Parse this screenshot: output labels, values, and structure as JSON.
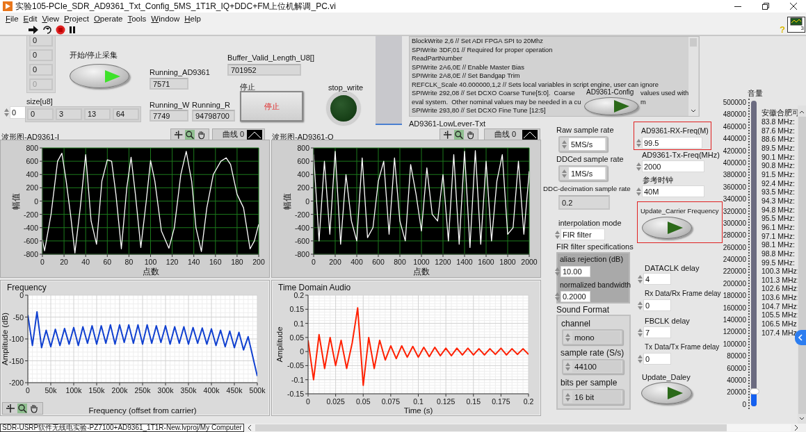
{
  "window": {
    "title": "实验105-PCIe_SDR_AD9361_Txt_Config_5MS_1T1R_IQ+DDC+FM上位机解调_PC.vi"
  },
  "menu": [
    "File",
    "Edit",
    "View",
    "Project",
    "Operate",
    "Tools",
    "Window",
    "Help"
  ],
  "help": "?",
  "vi_icon_number": "3",
  "data_array": {
    "values": [
      {
        "value": "0",
        "disabled": false
      },
      {
        "value": "0",
        "disabled": false
      },
      {
        "value": "0",
        "disabled": false
      },
      {
        "value": "0",
        "disabled": true
      }
    ]
  },
  "acquire_button": {
    "label": "开始/停止采集",
    "on": true
  },
  "running_ad9361": {
    "label": "Running_AD9361",
    "value": "7571",
    "kind": "indicator"
  },
  "buffer_valid_length": {
    "label": "Buffer_Valid_Length_U8[]",
    "value": "701952",
    "kind": "indicator"
  },
  "size_array": {
    "label": "size[u8]",
    "index": "0",
    "values": [
      "0",
      "3",
      "13",
      "64"
    ]
  },
  "running_w": {
    "label": "Running_W",
    "value": "7749",
    "kind": "indicator"
  },
  "running_r": {
    "label": "Running_R",
    "value": "94798700",
    "kind": "indicator"
  },
  "stop_button": {
    "label": "停止",
    "text": "停止"
  },
  "stop_write": {
    "label": "stop_write",
    "on": false
  },
  "lowlevel_txt": {
    "label": "AD9361-LowLever-Txt",
    "lines": [
      [
        "BlockWrite 2,6 // Set ADI FPGA SPI to 20Mhz"
      ],
      [
        "SPIWrite 3DF,01 // Required for proper operation"
      ],
      [
        "ReadPartNumber"
      ],
      [
        "SPIWrite 2A6,0E // Enable Master Bias"
      ],
      [
        "SPIWrite 2A8,0E // Set Bandgap Trim"
      ],
      [
        "REFCLK_Scale 40.000000,1,2 // Sets local variables in script engine, user can ignore"
      ],
      [
        "SPIWrite 292,08 // Set DCXO Coarse Tune[5:0].  Coarse",
        "values used with"
      ],
      [
        "eval system.  Other nominal values may be needed in a cu",
        "m"
      ],
      [
        "SPIWrite 293,80 // Set DCXO Fine Tune [12:5]"
      ]
    ]
  },
  "config_button": {
    "label": "AD9361-Config",
    "on": false
  },
  "graph_i": {
    "label": "波形图-AD9361-I",
    "chart_data": {
      "type": "line",
      "grid": true,
      "xlabel": "点数",
      "ylabel": "幅值",
      "xlim": [
        0,
        200
      ],
      "ylim": [
        -800,
        800
      ],
      "xticks": [
        0,
        20,
        40,
        60,
        80,
        100,
        120,
        140,
        160,
        180,
        200
      ],
      "yticks": [
        -800,
        -600,
        -400,
        -200,
        0,
        200,
        400,
        600,
        800
      ],
      "x": [
        0,
        2,
        8,
        14,
        18,
        22,
        26,
        30,
        35,
        40,
        45,
        50,
        55,
        60,
        64,
        68,
        73,
        78,
        82,
        86,
        91,
        96,
        100,
        104,
        110,
        117,
        122,
        128,
        133,
        138,
        142,
        147,
        152,
        158,
        165,
        170,
        174,
        180,
        186,
        192,
        196,
        200
      ],
      "series": [
        {
          "name": "曲线 0",
          "color": "#ffffff",
          "values": [
            -580,
            -750,
            -200,
            600,
            720,
            300,
            -200,
            -780,
            -100,
            700,
            -300,
            -650,
            300,
            620,
            600,
            100,
            -720,
            200,
            660,
            100,
            -700,
            0,
            610,
            300,
            -450,
            -710,
            -400,
            400,
            750,
            300,
            -400,
            -760,
            -100,
            400,
            600,
            650,
            550,
            100,
            -100,
            -720,
            -600,
            -350
          ]
        }
      ]
    }
  },
  "graph_q": {
    "label": "波形图-AD9361-Q",
    "chart_data": {
      "type": "line",
      "grid": true,
      "xlabel": "点数",
      "ylabel": "幅值",
      "xlim": [
        0,
        2000
      ],
      "ylim": [
        -800,
        800
      ],
      "xticks": [
        0,
        200,
        400,
        600,
        800,
        1000,
        1200,
        1400,
        1600,
        1800,
        2000
      ],
      "yticks": [
        -800,
        -600,
        -400,
        -200,
        0,
        200,
        400,
        600,
        800
      ],
      "x": [
        0,
        50,
        100,
        150,
        200,
        250,
        300,
        350,
        400,
        450,
        500,
        550,
        600,
        650,
        700,
        750,
        800,
        850,
        900,
        950,
        1000,
        1050,
        1100,
        1150,
        1200,
        1250,
        1300,
        1350,
        1400,
        1450,
        1500,
        1550,
        1600,
        1650,
        1700,
        1750,
        1800,
        1850,
        1900,
        1950,
        2000
      ],
      "series": [
        {
          "name": "曲线 0",
          "color": "#ffffff",
          "values": [
            700,
            -600,
            600,
            -500,
            750,
            -650,
            400,
            -300,
            -600,
            650,
            -550,
            -400,
            300,
            600,
            -500,
            650,
            -300,
            -600,
            550,
            100,
            -450,
            500,
            -200,
            -300,
            400,
            -600,
            700,
            -650,
            750,
            -700,
            760,
            -650,
            600,
            -600,
            300,
            700,
            -500,
            -400,
            600,
            -500,
            450
          ]
        }
      ]
    }
  },
  "raw_sample_rate": {
    "label": "Raw sample rate",
    "value": "5MS/s",
    "kind": "ring"
  },
  "ddced_sample_rate": {
    "label": "DDCed sample rate",
    "value": "1MS/s",
    "kind": "ring"
  },
  "ddc_decimation": {
    "label": "DDC-decimation sample rate",
    "value": "0.2",
    "kind": "indicator"
  },
  "interpolation_mode": {
    "label": "interpolation mode",
    "value": "FIR filter",
    "kind": "control"
  },
  "fir_spec": {
    "label": "FIR filter specifications",
    "alias_rejection": {
      "label": "alias rejection (dB)",
      "value": "10.00",
      "kind": "control"
    },
    "normalized_bandwidth": {
      "label": "normalized bandwidth",
      "value": "0.2000",
      "kind": "control"
    }
  },
  "sound_format": {
    "label": "Sound Format",
    "channel": {
      "label": "channel",
      "value": "mono",
      "kind": "ring_indicator"
    },
    "sample_rate": {
      "label": "sample rate (S/s)",
      "value": "44100",
      "kind": "ring_indicator"
    },
    "bits_per_sample": {
      "label": "bits per sample",
      "value": "16 bit",
      "kind": "ring_indicator"
    }
  },
  "rx_freq": {
    "label": "AD9361-RX-Freq(M)",
    "value": "99.5",
    "kind": "control",
    "highlighted": true
  },
  "tx_freq": {
    "label": "AD9361-Tx-Freq(MHz)",
    "value": "2000",
    "kind": "control"
  },
  "ref_clock": {
    "label": "参考时钟",
    "value": "40M",
    "kind": "control"
  },
  "update_carrier": {
    "label": "Update_Carrier Frequency",
    "on": false,
    "highlighted": true
  },
  "dataclk_delay": {
    "label": "DATACLK delay",
    "value": "4",
    "kind": "control"
  },
  "rx_frame_delay": {
    "label": "Rx Data/Rx Frame delay",
    "value": "0",
    "kind": "control"
  },
  "fbclk_delay": {
    "label": "FBCLK delay",
    "value": "7",
    "kind": "control"
  },
  "tx_frame_delay": {
    "label": "Tx Data/Tx Frame delay",
    "value": "0",
    "kind": "control"
  },
  "update_delay": {
    "label": "Update_Daley",
    "on": false
  },
  "volume": {
    "label": "音量",
    "level": 0.05,
    "scale": [
      "500000",
      "480000",
      "460000",
      "440000",
      "420000",
      "400000",
      "380000",
      "360000",
      "340000",
      "320000",
      "300000",
      "280000",
      "260000",
      "240000",
      "220000",
      "200000",
      "180000",
      "160000",
      "140000",
      "120000",
      "100000",
      "80000",
      "60000",
      "40000",
      "20000",
      "0"
    ]
  },
  "stations": {
    "title": "安徽合肥可",
    "items": [
      "83.8 MHz:",
      "87.6 MHz:",
      "88.6 MHz:",
      "89.5 MHz:",
      "90.1 MHz:",
      "90.8 MHz:",
      "91.5 MHz:",
      "92.4 MHz:",
      "93.5 MHz:",
      "94.3 MHz:",
      "94.8 MHz:",
      "95.5 MHz:",
      "96.1 MHz:",
      "97.1 MHz:",
      "98.1 MHz:",
      "98.8 MHz:",
      "99.5 MHz:",
      "100.3 MHz:",
      "101.3 MHz:",
      "102.6 MHz:",
      "103.6 MHz:",
      "104.7 MHz:",
      "105.5 MHz:",
      "106.5 MHz",
      "107.4 MHz"
    ]
  },
  "frequency_graph": {
    "title": "Frequency",
    "chart_data": {
      "type": "line",
      "grid": true,
      "xlabel": "Frequency (offset from carrier)",
      "ylabel": "Amplitude (dB)",
      "xlim": [
        0,
        500000
      ],
      "ylim": [
        -200,
        0
      ],
      "yticks": [
        0,
        -50,
        -100,
        -150,
        -200
      ],
      "xticks": [
        0,
        {
          "value": 50000,
          "label": "50k"
        },
        {
          "value": 100000,
          "label": "100k"
        },
        {
          "value": 150000,
          "label": "150k"
        },
        {
          "value": 200000,
          "label": "200k"
        },
        {
          "value": 250000,
          "label": "250k"
        },
        {
          "value": 300000,
          "label": "300k"
        },
        {
          "value": 350000,
          "label": "350k"
        },
        {
          "value": 400000,
          "label": "400k"
        },
        {
          "value": 450000,
          "label": "450k"
        },
        {
          "value": 500000,
          "label": "500k"
        }
      ],
      "x": [
        0,
        10000,
        20000,
        30000,
        40000,
        50000,
        60000,
        70000,
        80000,
        90000,
        100000,
        110000,
        120000,
        130000,
        140000,
        150000,
        160000,
        170000,
        180000,
        190000,
        200000,
        210000,
        220000,
        230000,
        240000,
        250000,
        260000,
        270000,
        280000,
        290000,
        300000,
        310000,
        320000,
        330000,
        340000,
        350000,
        360000,
        370000,
        380000,
        390000,
        400000,
        410000,
        420000,
        430000,
        440000,
        450000,
        460000,
        470000,
        480000,
        490000,
        500000
      ],
      "series": [
        {
          "color": "#1040d0",
          "values": [
            -45,
            -115,
            -38,
            -120,
            -80,
            -118,
            -78,
            -115,
            -76,
            -112,
            -74,
            -115,
            -72,
            -110,
            -70,
            -112,
            -70,
            -110,
            -68,
            -112,
            -68,
            -108,
            -68,
            -110,
            -68,
            -112,
            -68,
            -110,
            -70,
            -108,
            -70,
            -112,
            -72,
            -110,
            -72,
            -112,
            -74,
            -110,
            -75,
            -112,
            -77,
            -115,
            -80,
            -118,
            -82,
            -120,
            -85,
            -125,
            -95,
            -140,
            -185
          ]
        }
      ]
    }
  },
  "audio_graph": {
    "title": "Time Domain Audio",
    "chart_data": {
      "type": "line",
      "grid": true,
      "xlabel": "Time (s)",
      "ylabel": "Amplitude",
      "xlim": [
        0,
        0.2
      ],
      "ylim": [
        -0.15,
        0.2
      ],
      "yticks": [
        -0.15,
        -0.1,
        -0.05,
        0,
        0.05,
        0.1,
        0.15,
        0.2
      ],
      "xticks": [
        0,
        0.025,
        0.05,
        0.075,
        0.1,
        0.125,
        0.15,
        0.175,
        0.2
      ],
      "x": [
        0,
        0.005,
        0.01,
        0.015,
        0.02,
        0.025,
        0.03,
        0.035,
        0.04,
        0.045,
        0.05,
        0.055,
        0.06,
        0.065,
        0.07,
        0.075,
        0.08,
        0.085,
        0.09,
        0.095,
        0.1,
        0.105,
        0.11,
        0.115,
        0.12,
        0.125,
        0.13,
        0.135,
        0.14,
        0.145,
        0.15,
        0.155,
        0.16,
        0.165,
        0.17,
        0.175,
        0.18,
        0.185,
        0.19,
        0.195,
        0.2
      ],
      "series": [
        {
          "color": "#ff2000",
          "values": [
            0.04,
            -0.1,
            0.06,
            -0.06,
            0.05,
            -0.05,
            0.04,
            -0.06,
            0.03,
            0.155,
            -0.12,
            0.05,
            -0.06,
            0.04,
            -0.03,
            0.02,
            -0.025,
            0.02,
            -0.02,
            0.018,
            -0.02,
            0.015,
            -0.018,
            0.015,
            -0.015,
            0.012,
            -0.015,
            0.012,
            -0.012,
            0.012,
            -0.012,
            0.01,
            -0.012,
            0.01,
            -0.01,
            0.012,
            -0.012,
            0.01,
            -0.01,
            0.01,
            -0.01
          ]
        }
      ]
    }
  },
  "status_bar": {
    "path": "SDR-USRP软件无线电实验-PZ7100+AD9361_1T1R-New.lvproj/My Computer"
  }
}
